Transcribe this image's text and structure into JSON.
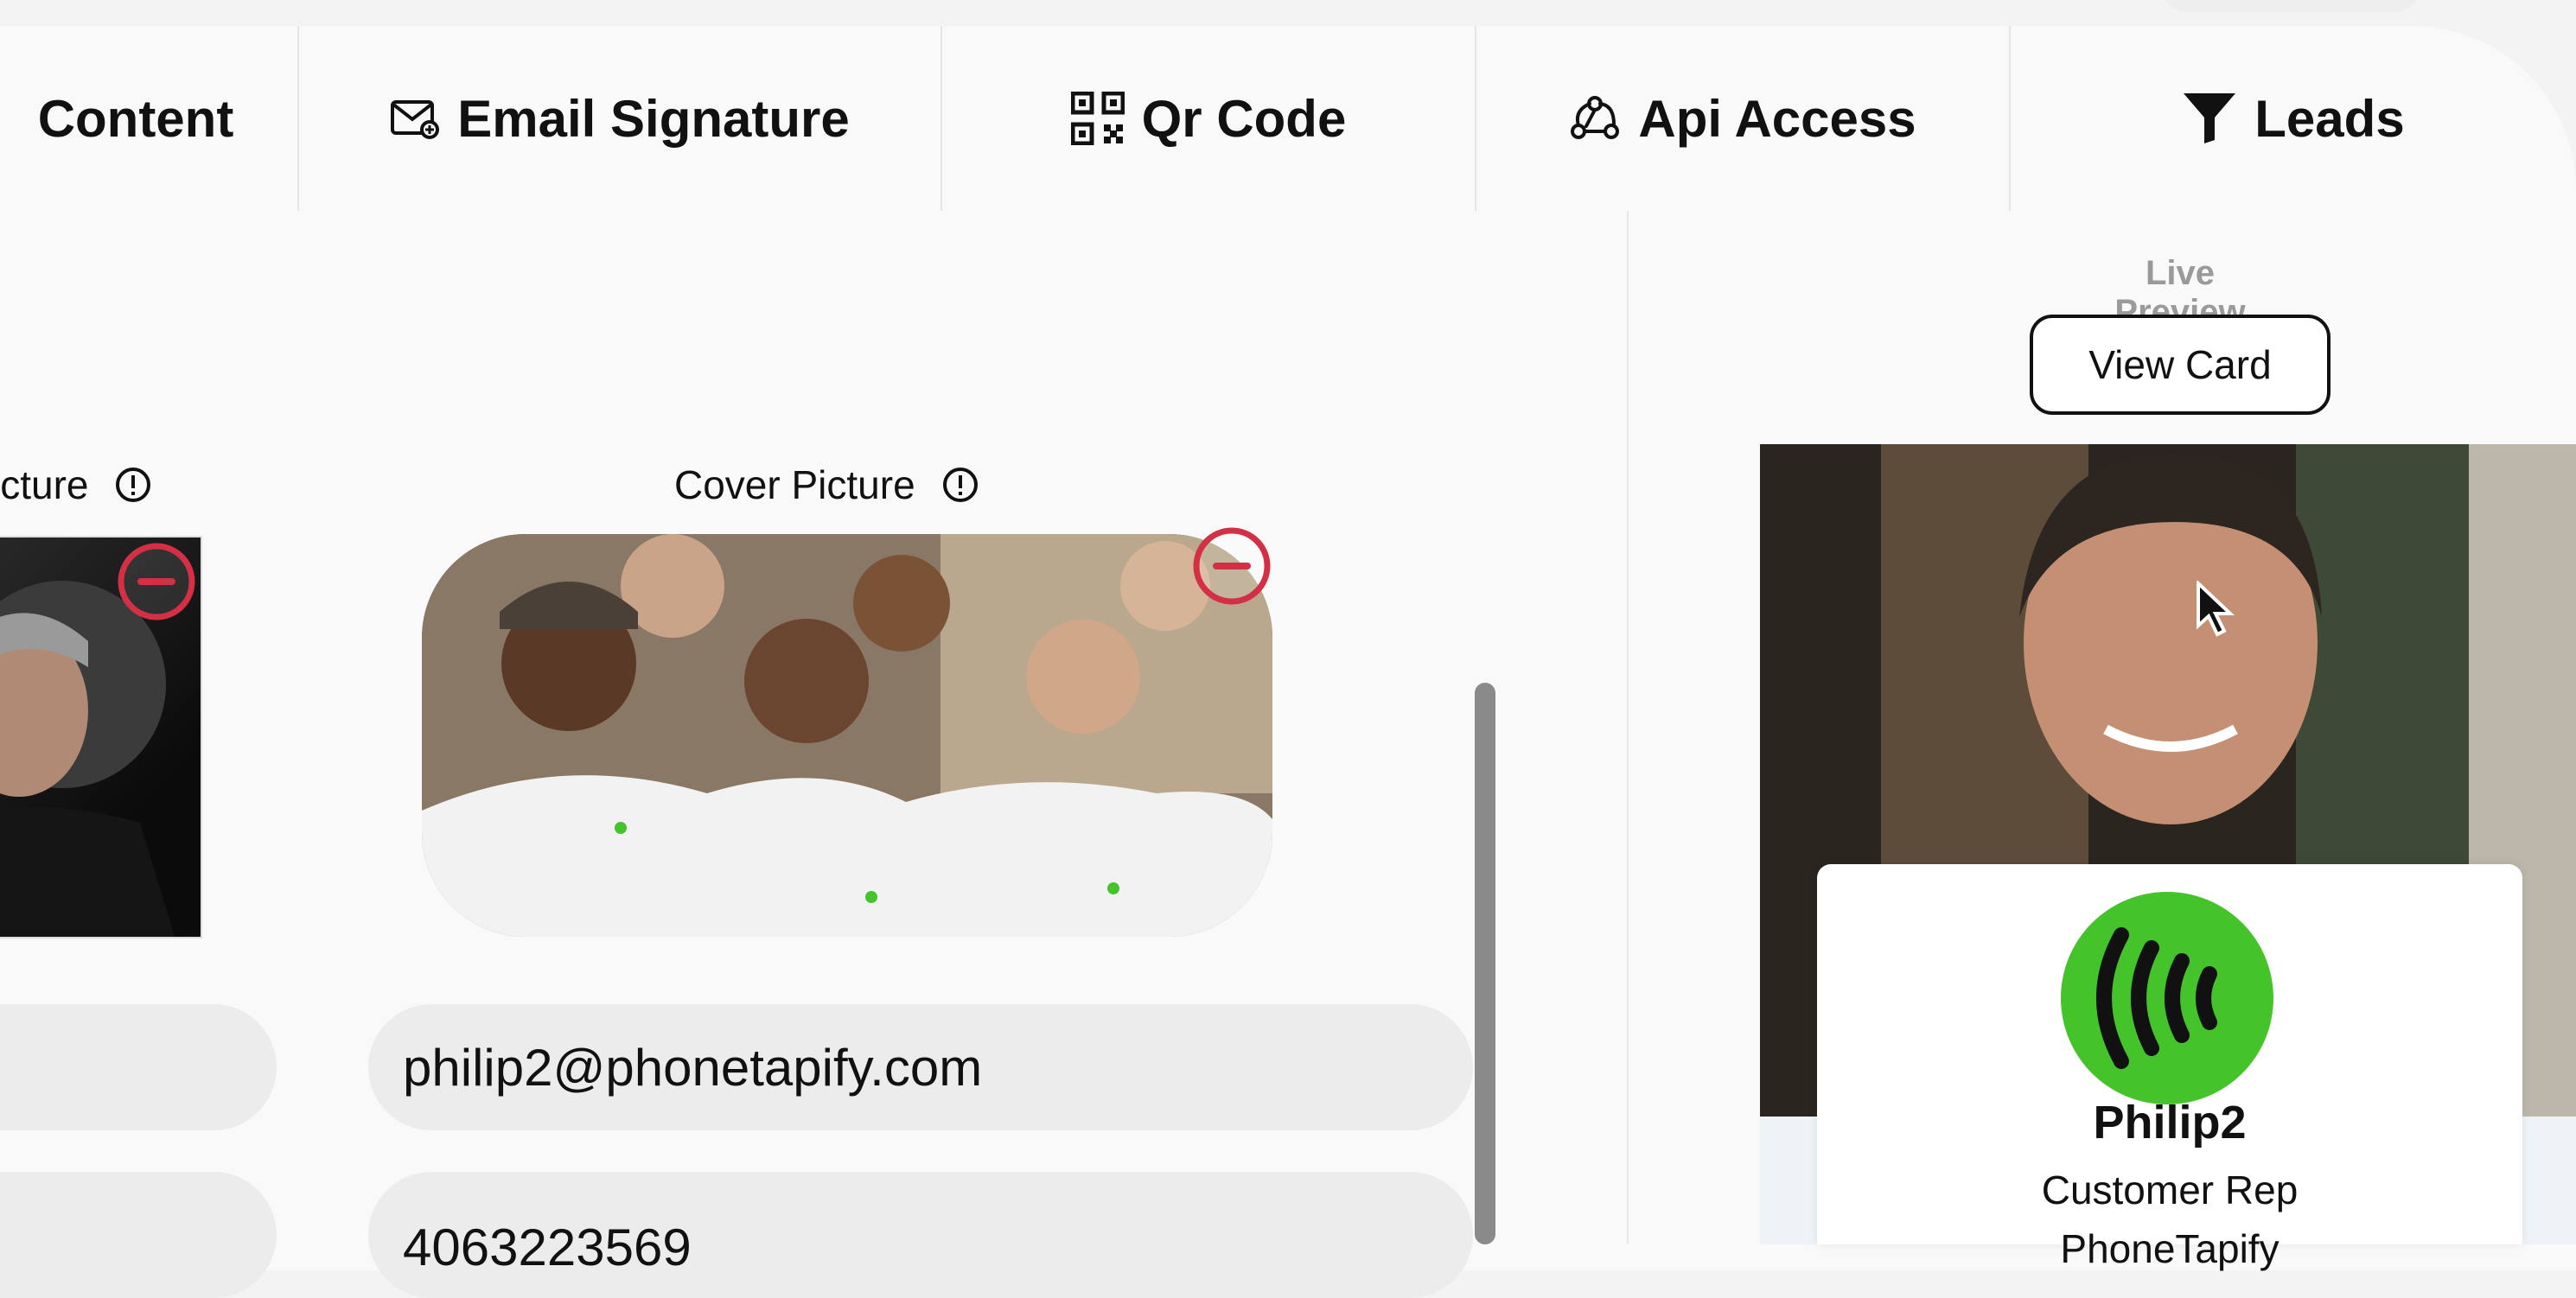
{
  "tabs": [
    {
      "label": "Content",
      "icon": "content-icon"
    },
    {
      "label": "Email Signature",
      "icon": "envelope-icon"
    },
    {
      "label": "Qr Code",
      "icon": "qr-code-icon"
    },
    {
      "label": "Api Access",
      "icon": "webhook-icon"
    },
    {
      "label": "Leads",
      "icon": "filter-icon"
    }
  ],
  "editor": {
    "profile_picture_label": "icture",
    "cover_picture_label": "Cover Picture",
    "email_value": "philip2@phonetapify.com",
    "phone_value": "4063223569"
  },
  "preview": {
    "label": "Live Preview",
    "view_card_label": "View Card",
    "name": "Philip2",
    "role": "Customer Rep",
    "company": "PhoneTapify"
  },
  "colors": {
    "remove_red": "#d32f45",
    "logo_green": "#44c42a",
    "field_bg": "#ececec"
  }
}
